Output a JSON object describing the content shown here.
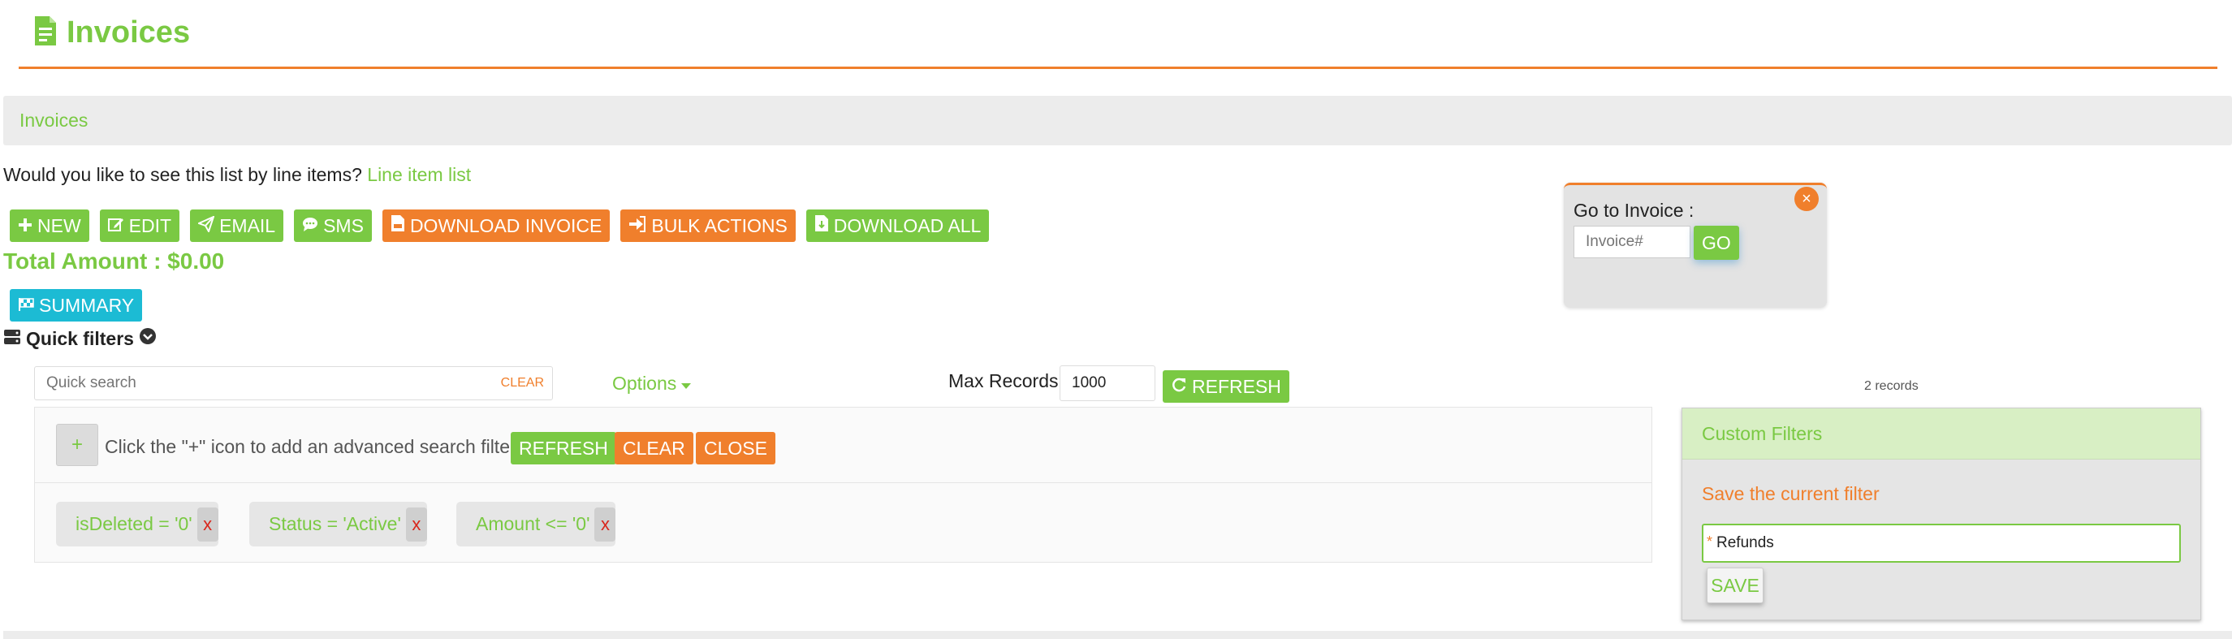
{
  "header": {
    "title": "Invoices",
    "icon": "file-invoice-icon"
  },
  "breadcrumb": {
    "label": "Invoices"
  },
  "line_item_prompt": {
    "question": "Would you like to see this list by line items?",
    "link": "Line item list"
  },
  "toolbar": {
    "new": "NEW",
    "edit": "EDIT",
    "email": "EMAIL",
    "sms": "SMS",
    "download_invoice": "DOWNLOAD INVOICE",
    "bulk_actions": "BULK ACTIONS",
    "download_all": "DOWNLOAD ALL"
  },
  "total_amount": "Total Amount : $0.00",
  "summary": "SUMMARY",
  "quick_filters": "Quick filters",
  "goto_invoice": {
    "label": "Go to Invoice :",
    "placeholder": "Invoice#",
    "go": "GO",
    "close": "×"
  },
  "search": {
    "placeholder": "Quick search",
    "clear": "CLEAR"
  },
  "options": "Options",
  "max_records": {
    "label": "Max Records",
    "value": "1000",
    "refresh": "REFRESH"
  },
  "records_count": "2 records",
  "advanced": {
    "plus": "+",
    "hint": "Click the \"+\" icon to add an advanced search filter",
    "refresh": "REFRESH",
    "clear": "CLEAR",
    "close": "CLOSE",
    "chips": [
      {
        "label": "isDeleted = '0'",
        "remove": "x"
      },
      {
        "label": "Status = 'Active'",
        "remove": "x"
      },
      {
        "label": "Amount <= '0'",
        "remove": "x"
      }
    ]
  },
  "custom_filters": {
    "title": "Custom Filters",
    "save_label": "Save the current filter",
    "required_mark": "*",
    "value": "Refunds",
    "save": "SAVE"
  },
  "colors": {
    "green": "#7ac943",
    "orange": "#f07f2c",
    "teal": "#1cbbd4"
  }
}
